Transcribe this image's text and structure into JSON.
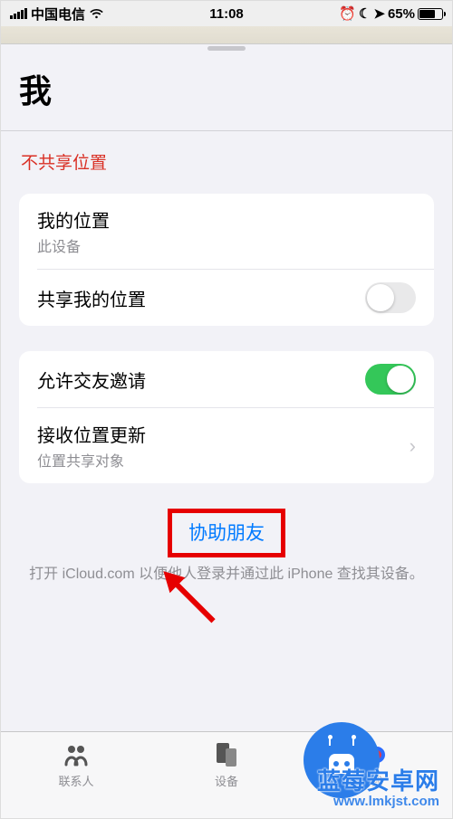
{
  "statusbar": {
    "carrier": "中国电信",
    "time": "11:08",
    "battery_pct": "65%"
  },
  "sheet": {
    "title": "我",
    "not_sharing_label": "不共享位置"
  },
  "group1": {
    "my_location_title": "我的位置",
    "my_location_sub": "此设备",
    "share_location_title": "共享我的位置",
    "share_location_on": false
  },
  "group2": {
    "allow_invite_title": "允许交友邀请",
    "allow_invite_on": true,
    "receive_update_title": "接收位置更新",
    "receive_update_sub": "位置共享对象"
  },
  "help": {
    "link_text": "协助朋友",
    "description": "打开 iCloud.com 以便他人登录并通过此 iPhone 查找其设备。"
  },
  "tabbar": {
    "people": "联系人",
    "devices": "设备",
    "me": "我"
  },
  "watermark": {
    "line1": "蓝莓安卓网",
    "line2": "www.lmkjst.com"
  },
  "colors": {
    "accent_red": "#e60000",
    "link_blue": "#007aff",
    "switch_green": "#34c759"
  }
}
